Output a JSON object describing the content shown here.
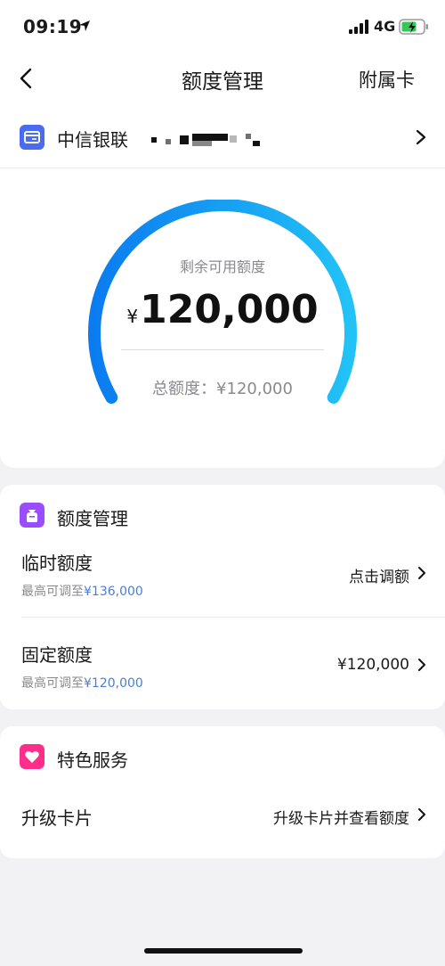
{
  "status_bar": {
    "time": "09:19",
    "network": "4G"
  },
  "nav": {
    "title": "额度管理",
    "right_link": "附属卡"
  },
  "card": {
    "bank_name": "中信银联"
  },
  "gauge": {
    "label": "剩余可用额度",
    "currency": "¥",
    "amount": "120,000",
    "total_text": "总额度：¥120,000",
    "fraction": 1.0,
    "colors": [
      "#0a7cf0",
      "#22c2f6"
    ]
  },
  "limit_section": {
    "title": "额度管理",
    "icon": "wallet-bag-icon",
    "icon_color": "#9a4dff",
    "rows": [
      {
        "title": "临时额度",
        "sub_prefix": "最高可调至",
        "sub_value": "¥136,000",
        "value": "点击调额"
      },
      {
        "title": "固定额度",
        "sub_prefix": "最高可调至",
        "sub_value": "¥120,000",
        "value": "¥120,000"
      }
    ]
  },
  "service_section": {
    "title": "特色服务",
    "icon": "heart-icon",
    "icon_color": "#ff2e8a",
    "rows": [
      {
        "title": "升级卡片",
        "value": "升级卡片并查看额度"
      }
    ]
  }
}
